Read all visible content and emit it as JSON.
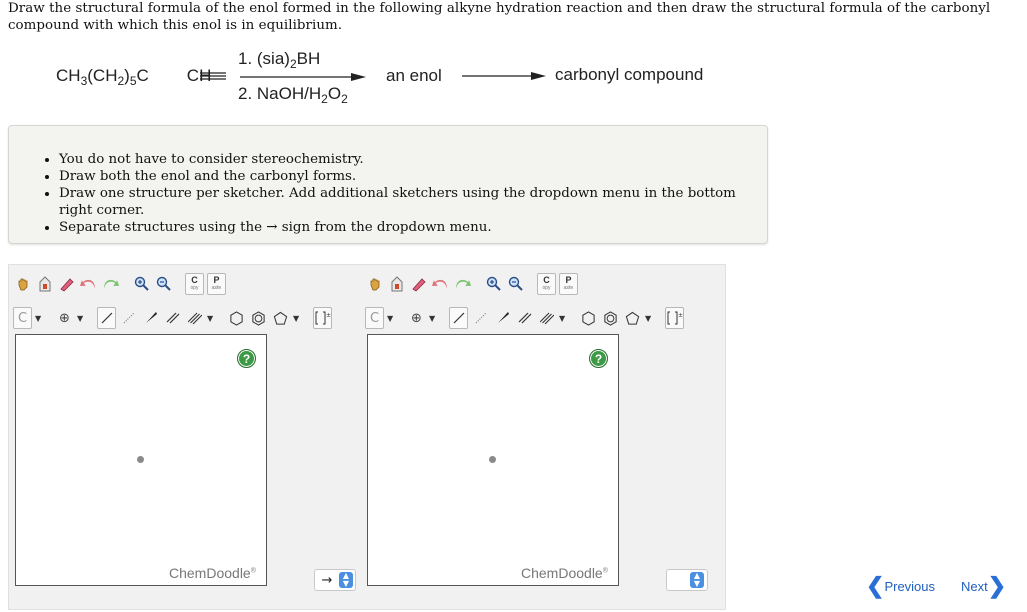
{
  "question": {
    "text": "Draw the structural formula of the enol formed in the following alkyne hydration reaction and then draw the structural formula of the carbonyl compound with which this enol is in equilibrium."
  },
  "reaction": {
    "starting_material": "CH3(CH2)5C≡CH",
    "reagent_1": "1. (sia)2BH",
    "reagent_2": "2. NaOH/H2O2",
    "product_1": "an enol",
    "product_2": "carbonyl compound"
  },
  "hints": [
    "You do not have to consider stereochemistry.",
    "Draw both the enol and the carbonyl forms.",
    "Draw one structure per sketcher. Add additional sketchers using the dropdown menu in the bottom right corner.",
    "Separate structures using the → sign from the dropdown menu."
  ],
  "sketcher": {
    "copy_label": "C",
    "copy_sub": "opy",
    "paste_label": "P",
    "paste_sub": "aste",
    "element_label": "C",
    "help_label": "?",
    "brand": "ChemDoodle",
    "brand_mark": "®"
  },
  "separator_select": {
    "value": "→"
  },
  "nav": {
    "previous_label": "Previous",
    "next_label": "Next"
  },
  "colors": {
    "accent": "#2a6fd6",
    "help_green": "#3c9a44",
    "select_blue": "#4a8fe0"
  }
}
